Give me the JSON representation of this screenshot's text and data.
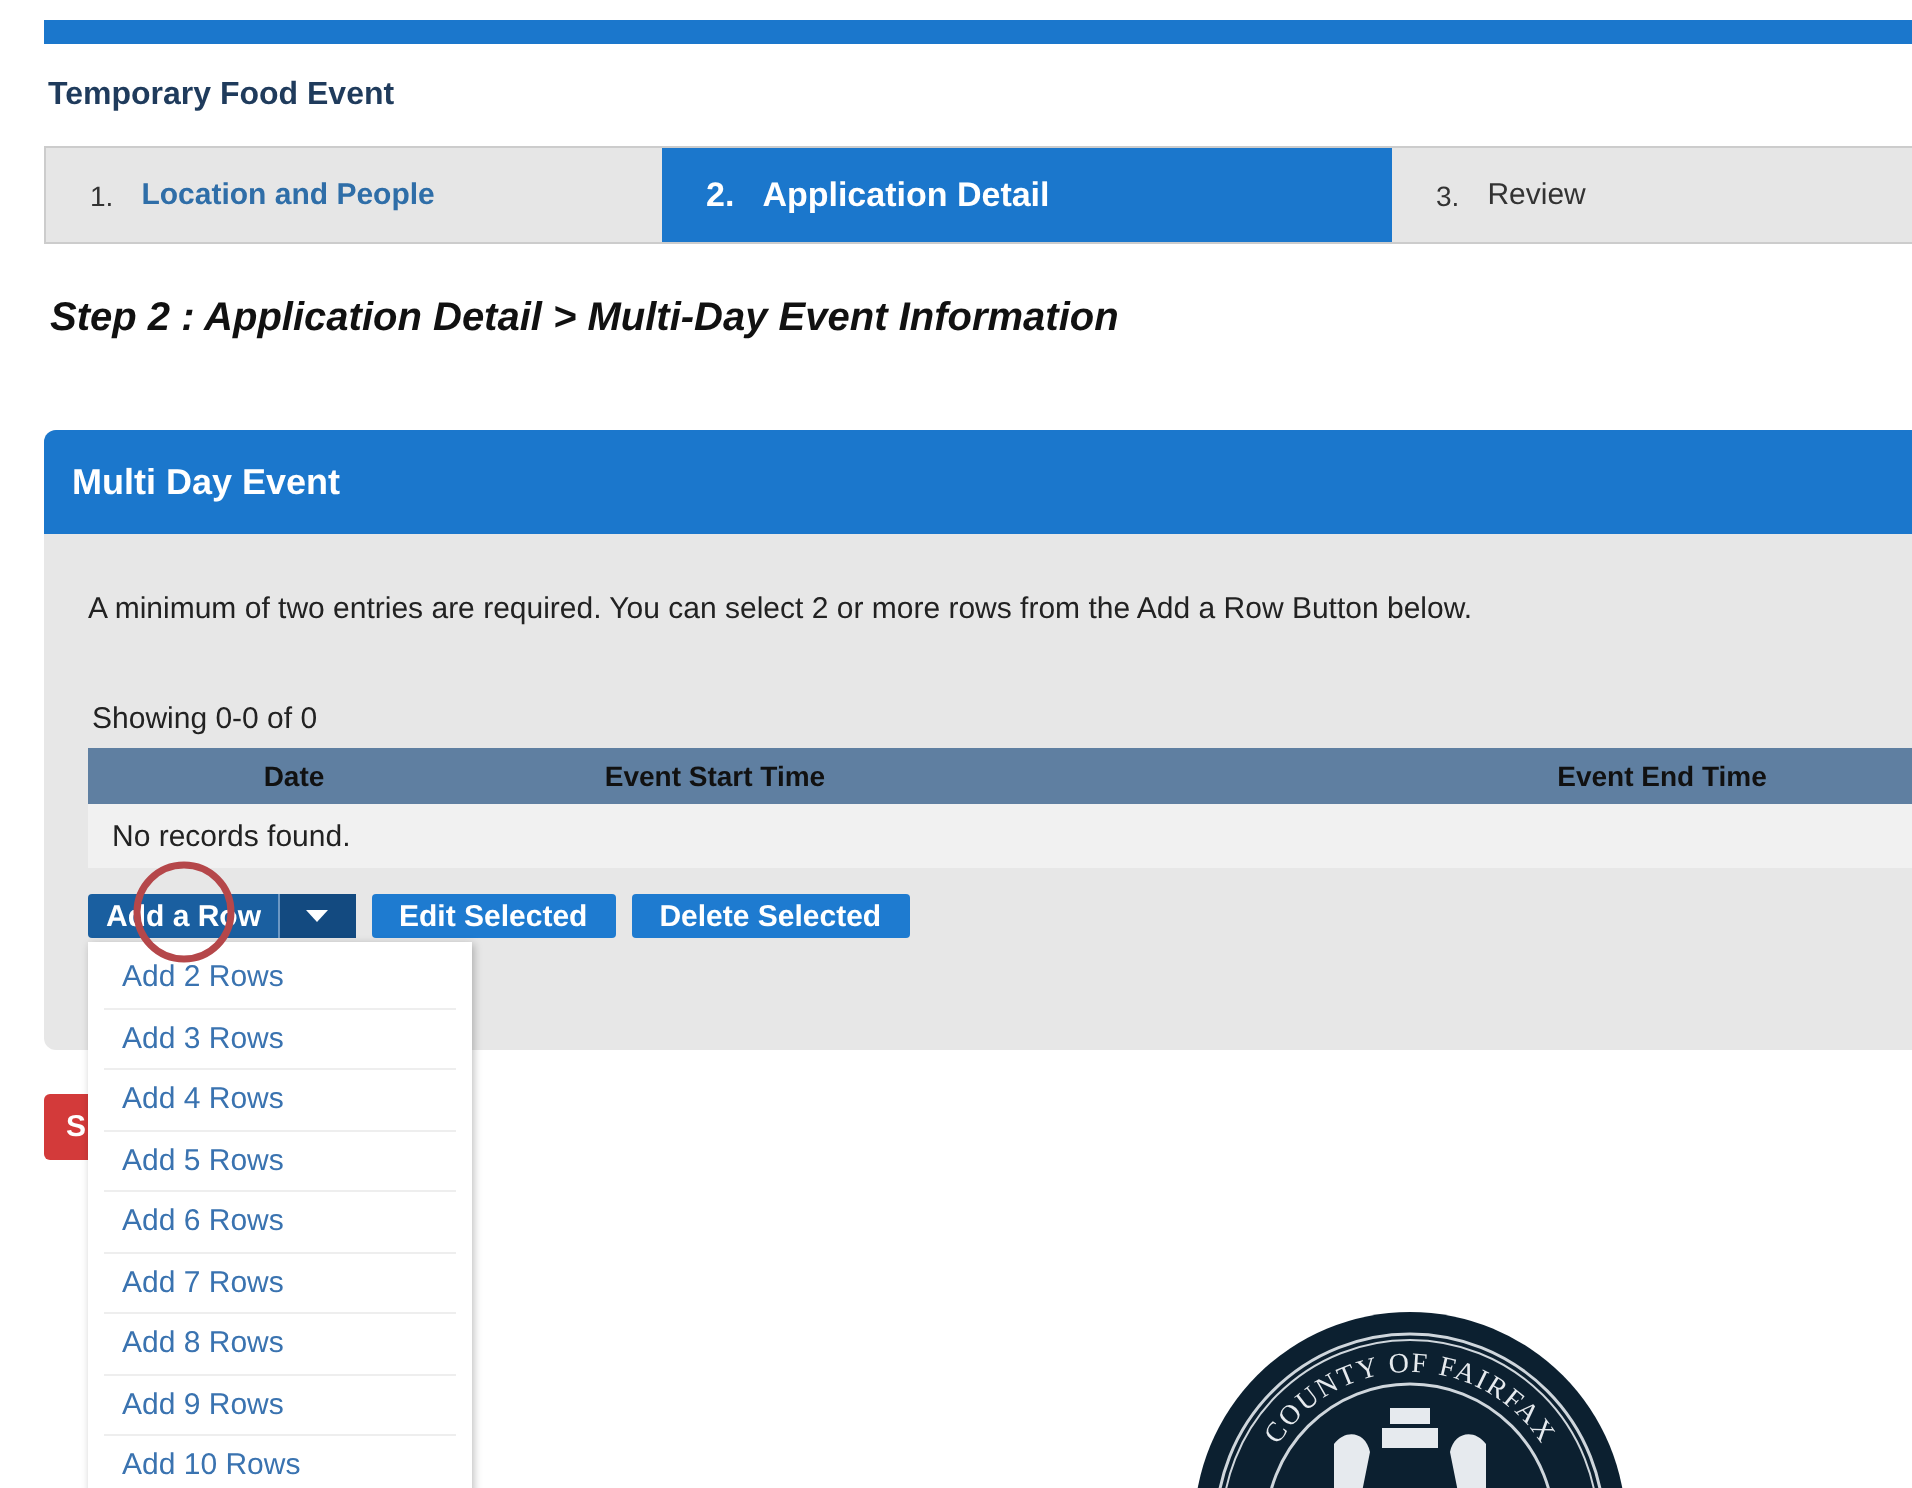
{
  "page_title": "Temporary Food Event",
  "steps": [
    {
      "number": "1.",
      "label": "Location and People",
      "selected": false
    },
    {
      "number": "2.",
      "label": "Application Detail",
      "selected": true
    },
    {
      "number": "3.",
      "label": "Review",
      "selected": false
    }
  ],
  "step_heading": "Step 2 : Application Detail > Multi-Day Event Information",
  "panel": {
    "title": "Multi Day Event",
    "info": "A minimum of two entries are required. You can select 2 or more rows from the Add a Row Button below.",
    "table": {
      "summary": "Showing 0-0 of 0",
      "columns": [
        "Date",
        "Event Start Time",
        "Event End Time"
      ],
      "empty_message": "No records found."
    },
    "buttons": {
      "add_row": "Add a Row",
      "edit": "Edit Selected",
      "delete": "Delete Selected"
    },
    "add_row_menu": {
      "expanded": true,
      "items": [
        "Add 2 Rows",
        "Add 3 Rows",
        "Add 4 Rows",
        "Add 5 Rows",
        "Add 6 Rows",
        "Add 7 Rows",
        "Add 8 Rows",
        "Add 9 Rows",
        "Add 10 Rows"
      ]
    }
  },
  "partial_button": "S",
  "seal": {
    "text": "COUNTY OF FAIRFAX"
  }
}
